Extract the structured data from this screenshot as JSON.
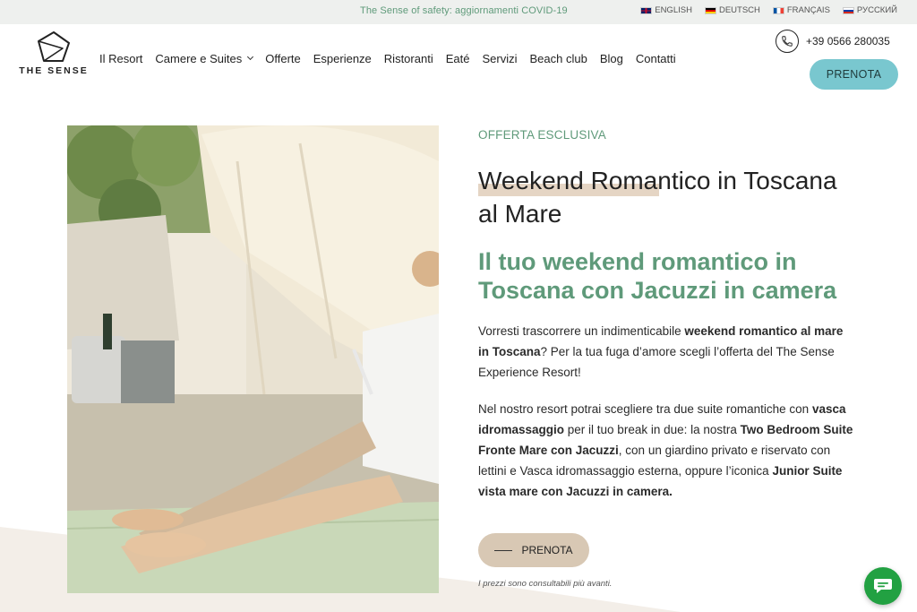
{
  "topbar": {
    "notice": "The Sense of safety: aggiornamenti COVID-19",
    "languages": [
      {
        "label": "ENGLISH",
        "flag": "uk-flag-icon"
      },
      {
        "label": "DEUTSCH",
        "flag": "germany-flag-icon"
      },
      {
        "label": "FRANÇAIS",
        "flag": "france-flag-icon"
      },
      {
        "label": "РУССКИЙ",
        "flag": "russia-flag-icon"
      }
    ]
  },
  "header": {
    "logo_text": "THE SENSE",
    "phone": "+39 0566 280035",
    "cta": "PRENOTA"
  },
  "nav": {
    "items": [
      "Il Resort",
      "Camere e Suites",
      "Offerte",
      "Esperienze",
      "Ristoranti",
      "Eaté",
      "Servizi",
      "Beach club",
      "Blog",
      "Contatti"
    ]
  },
  "main": {
    "eyebrow": "OFFERTA ESCLUSIVA",
    "headline": "Weekend Romantico in Toscana al Mare",
    "subhead": "Il tuo weekend romantico in Toscana con Jacuzzi in camera",
    "p1": {
      "t1": "Vorresti trascorrere un indimenticabile ",
      "b1": "weekend romantico al mare in Toscana",
      "t2": "?  Per la tua fuga d’amore scegli l’offerta del The Sense Experience Resort!"
    },
    "p2": {
      "t1": "Nel nostro resort potrai scegliere tra due suite romantiche con ",
      "b1": "vasca idromassaggio",
      "t2": " per il tuo break in due: la nostra ",
      "b2": "Two Bedroom Suite Fronte Mare con Jacuzzi",
      "t3": ", con un giardino privato e riservato con lettini e Vasca idromassaggio esterna, oppure l’iconica ",
      "b3": "Junior Suite vista mare con Jacuzzi in camera."
    },
    "cta": "PRENOTA",
    "note": "I prezzi sono consultabili più avanti."
  },
  "colors": {
    "accent_green": "#5f9a7a",
    "cta_teal": "#79c7cf",
    "cta_beige": "#d8c8b4",
    "chat_green": "#22a142"
  }
}
